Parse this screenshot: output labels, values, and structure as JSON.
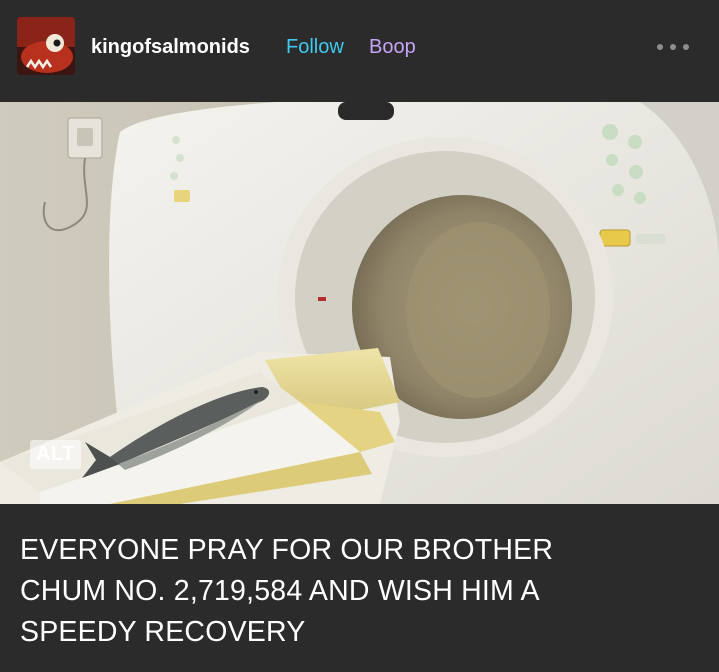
{
  "post": {
    "username": "kingofsalmonids",
    "follow_label": "Follow",
    "boop_label": "Boop",
    "alt_label": "ALT",
    "caption_lines": [
      "EVERYONE PRAY FOR OUR BROTHER",
      "CHUM NO. 2,719,584 AND WISH HIM A",
      "SPEEDY RECOVERY"
    ]
  },
  "colors": {
    "background": "#2b2b2b",
    "follow": "#3fc8f0",
    "boop": "#c7a3f5",
    "text": "#ffffff"
  },
  "icons": {
    "menu": "more-options-icon",
    "avatar": "avatar"
  }
}
